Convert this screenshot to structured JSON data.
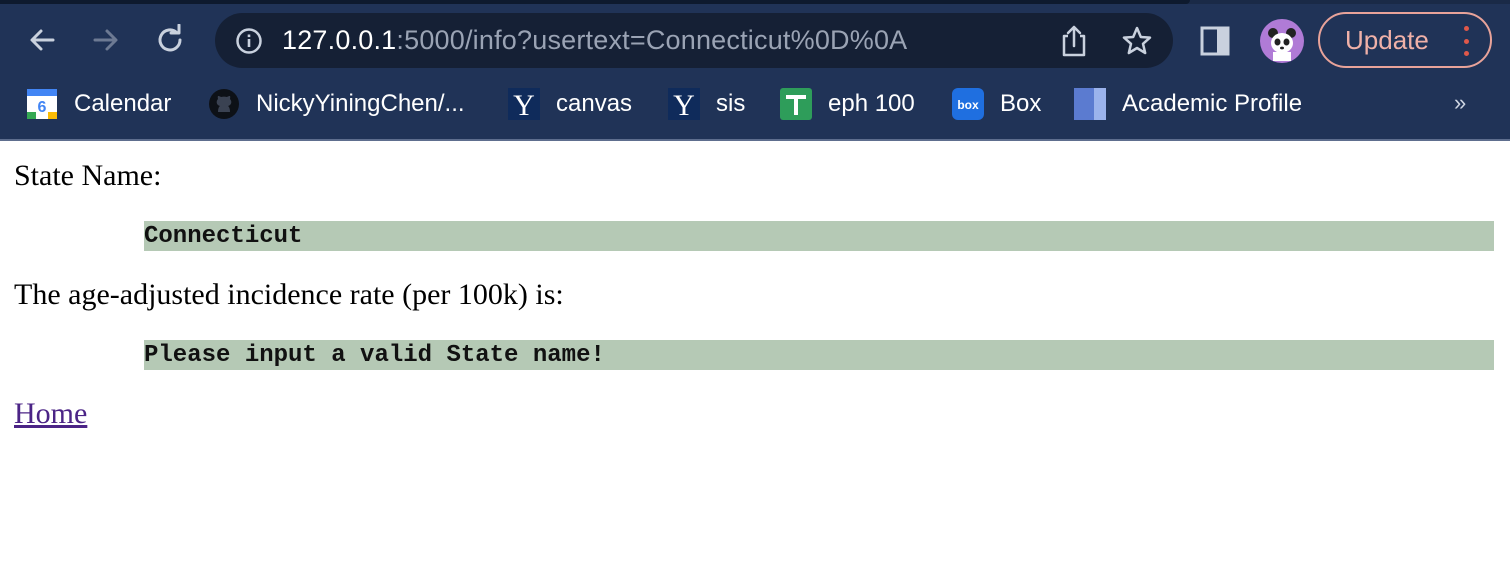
{
  "browser": {
    "url_host": "127.0.0.1",
    "url_rest": ":5000/info?usertext=Connecticut%0D%0A",
    "update_label": "Update",
    "bookmarks": [
      {
        "label": "Calendar",
        "icon": "calendar-icon"
      },
      {
        "label": "NickyYiningChen/...",
        "icon": "github-icon"
      },
      {
        "label": "canvas",
        "icon": "yale-icon"
      },
      {
        "label": "sis",
        "icon": "yale-icon"
      },
      {
        "label": "eph 100",
        "icon": "plus-icon"
      },
      {
        "label": "Box",
        "icon": "box-icon"
      },
      {
        "label": "Academic Profile",
        "icon": "profile-icon"
      }
    ],
    "more_label": "»",
    "calendar_day": "6",
    "box_logo_text": "box",
    "yale_letter": "Y"
  },
  "page": {
    "state_label": "State Name:",
    "state_value": "Connecticut",
    "rate_label": "The age-adjusted incidence rate (per 100k) is:",
    "rate_value": "Please input a valid State name!",
    "home_link": "Home"
  },
  "colors": {
    "chrome_bg": "#203357",
    "output_box_bg": "#b5c9b5",
    "link": "#4b2486"
  }
}
